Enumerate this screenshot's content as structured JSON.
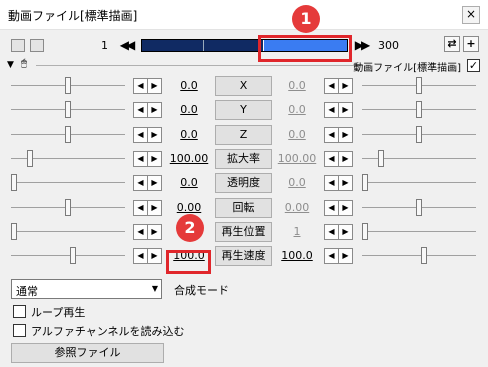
{
  "window": {
    "title": "動画ファイル[標準描画]",
    "close_label": "×"
  },
  "toolbar": {
    "frame_start": "1",
    "frame_end": "300",
    "prev_label": "◀◀",
    "next_label": "▶▶",
    "plus_label": "+",
    "sync_label": "⇄"
  },
  "object_label": "動画ファイル[標準描画]",
  "object_checked": "✓",
  "params": [
    {
      "name": "X",
      "left": "0.0",
      "right": "0.0",
      "slider_frac": 0.5,
      "right_frac": 0.5,
      "right_dim": true
    },
    {
      "name": "Y",
      "left": "0.0",
      "right": "0.0",
      "slider_frac": 0.5,
      "right_frac": 0.5,
      "right_dim": true
    },
    {
      "name": "Z",
      "left": "0.0",
      "right": "0.0",
      "slider_frac": 0.5,
      "right_frac": 0.5,
      "right_dim": true
    },
    {
      "name": "拡大率",
      "left": "100.00",
      "right": "100.00",
      "slider_frac": 0.15,
      "right_frac": 0.15,
      "right_dim": true
    },
    {
      "name": "透明度",
      "left": "0.0",
      "right": "0.0",
      "slider_frac": 0.0,
      "right_frac": 0.0,
      "right_dim": true
    },
    {
      "name": "回転",
      "left": "0.00",
      "right": "0.00",
      "slider_frac": 0.5,
      "right_frac": 0.5,
      "right_dim": true
    },
    {
      "name": "再生位置",
      "left": "1",
      "right": "1",
      "slider_frac": 0.0,
      "right_frac": 0.0,
      "right_dim": true
    },
    {
      "name": "再生速度",
      "left": "100.0",
      "right": "100.0",
      "slider_frac": 0.55,
      "right_frac": 0.55,
      "right_dim": false
    }
  ],
  "blend": {
    "selected": "通常",
    "label": "合成モード"
  },
  "options": {
    "loop": "ループ再生",
    "alpha": "アルファチャンネルを読み込む"
  },
  "ref_button": "参照ファイル",
  "annotations": {
    "badge1": "1",
    "badge2": "2"
  },
  "colors": {
    "highlight": "#e0262b",
    "timeline_bg": "#102a63",
    "timeline_sel": "#3a7cf2"
  }
}
